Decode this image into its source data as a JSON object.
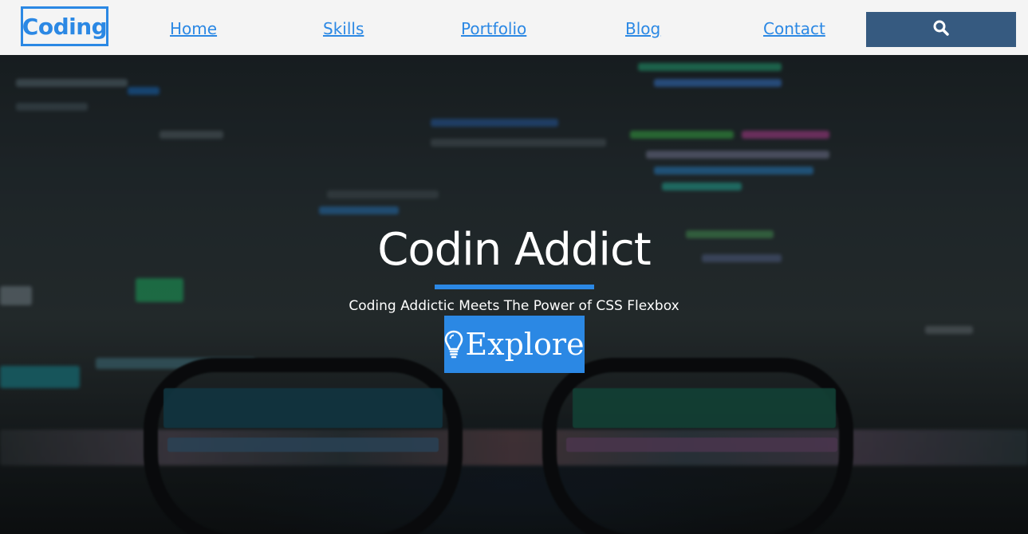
{
  "nav": {
    "logo": "Coding",
    "links": [
      "Home",
      "Skills",
      "Portfolio",
      "Blog",
      "Contact"
    ],
    "search_icon": "search-icon"
  },
  "hero": {
    "title": "Codin Addict",
    "subtitle": "Coding Addictic Meets The Power of CSS Flexbox",
    "button_label": "Explore",
    "button_icon": "lightbulb-icon"
  },
  "colors": {
    "accent": "#2b88e4",
    "search_bg": "#365a80",
    "nav_bg": "#f4f4f4"
  }
}
